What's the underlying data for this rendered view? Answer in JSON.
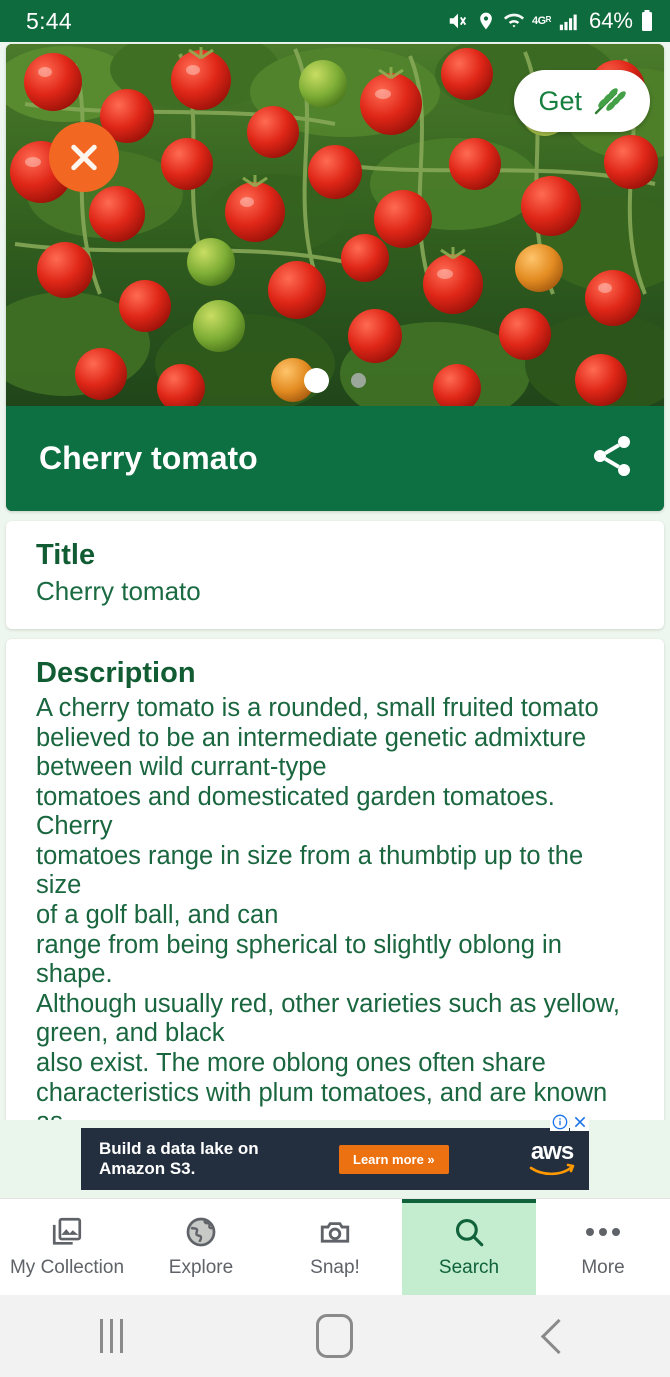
{
  "status_bar": {
    "time": "5:44",
    "battery_percent": "64%",
    "network_type": "4G",
    "network_roaming": "R",
    "icons": [
      "mute-icon",
      "location-icon",
      "wifi-icon",
      "signal-icon",
      "battery-icon"
    ]
  },
  "hero": {
    "close_label": "close",
    "get_label": "Get",
    "get_icon": "leaf-icon",
    "share_icon": "share-icon",
    "plant_name": "Cherry tomato",
    "carousel": {
      "total": 2,
      "active_index": 0
    }
  },
  "cards": [
    {
      "heading": "Title",
      "value": "Cherry tomato"
    },
    {
      "heading": "Description",
      "value": "A cherry tomato is a rounded, small fruited tomato\nbelieved to be an intermediate genetic admixture\nbetween wild currant-type\ntomatoes and domesticated garden tomatoes. Cherry\ntomatoes range in size from a thumbtip up to the size\nof a golf ball, and can\nrange from being spherical to slightly oblong in shape.\nAlthough usually red, other varieties such as yellow,\ngreen, and black\nalso exist. The more oblong ones often share\ncharacteristics with plum tomatoes, and are known as\ngrape tomatoes. The berry tomato\nis regarded as a botanical variety of the cultivated\nberry, Solanum lycopersicum var. cerasiforme"
    }
  ],
  "ad": {
    "headline": "Build a data lake on\nAmazon S3.",
    "cta": "Learn more »",
    "brand": "aws",
    "info_icon": "ad-info-icon",
    "close_icon": "ad-close-icon"
  },
  "tabbar": {
    "items": [
      {
        "label": "My Collection",
        "icon": "photo-collection-icon",
        "active": false
      },
      {
        "label": "Explore",
        "icon": "globe-icon",
        "active": false
      },
      {
        "label": "Snap!",
        "icon": "camera-icon",
        "active": false
      },
      {
        "label": "Search",
        "icon": "search-icon",
        "active": true
      },
      {
        "label": "More",
        "icon": "more-dots-icon",
        "active": false
      }
    ]
  },
  "android_nav": {
    "recents_label": "Recents",
    "home_label": "Home",
    "back_label": "Back"
  },
  "colors": {
    "brand_green": "#0d7042",
    "status_green": "#0d6b3d",
    "accent_orange": "#f26722",
    "active_tab_bg": "#c4ecce",
    "page_bg": "#eef7ef",
    "text_green": "#19663f"
  }
}
